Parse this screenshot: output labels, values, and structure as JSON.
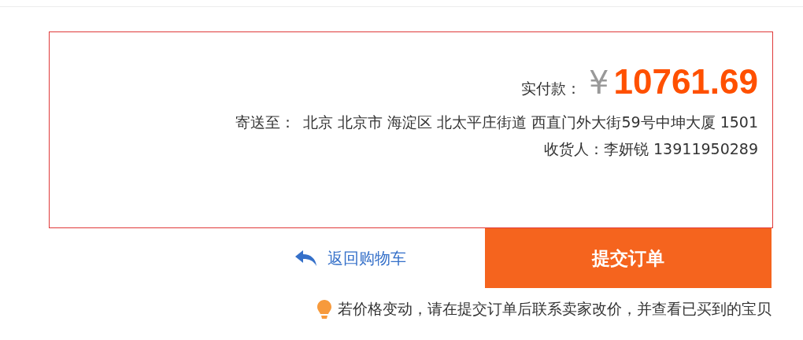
{
  "summary": {
    "paid_label": "实付款：",
    "currency": "¥",
    "amount": "10761.69",
    "ship_label": "寄送至：",
    "address": "北京 北京市 海淀区 北太平庄街道 西直门外大街59号中坤大厦 1501",
    "recipient_label": "收货人：",
    "recipient": "李妍锐 13911950289"
  },
  "actions": {
    "back_link": "返回购物车",
    "submit_button": "提交订单"
  },
  "notice": "若价格变动，请在提交订单后联系卖家改价，并查看已买到的宝贝"
}
